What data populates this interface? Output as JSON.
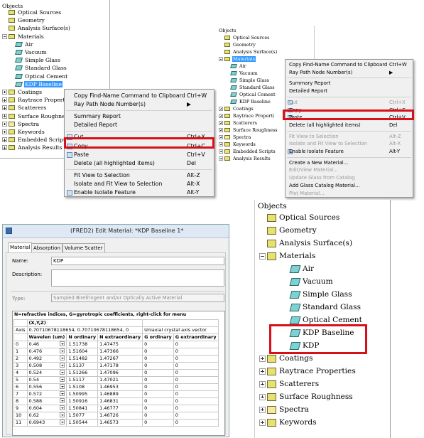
{
  "panel_a": {
    "tree_title": "Objects",
    "items": [
      {
        "label": "Optical Sources",
        "icon": "optical-sources-icon"
      },
      {
        "label": "Geometry",
        "icon": "geometry-icon"
      },
      {
        "label": "Analysis Surface(s)",
        "icon": "analysis-surface-icon"
      },
      {
        "label": "Materials",
        "icon": "materials-folder-icon"
      },
      {
        "label": "Air",
        "icon": "material-icon"
      },
      {
        "label": "Vacuum",
        "icon": "material-icon"
      },
      {
        "label": "Simple Glass",
        "icon": "material-icon"
      },
      {
        "label": "Standard Glass",
        "icon": "material-icon"
      },
      {
        "label": "Optical Cement",
        "icon": "material-icon"
      },
      {
        "label": "KDP Baseline",
        "icon": "material-icon"
      },
      {
        "label": "Coatings",
        "icon": "coatings-icon"
      },
      {
        "label": "Raytrace Propert",
        "icon": "raytrace-properties-icon"
      },
      {
        "label": "Scatterers",
        "icon": "scatterers-icon"
      },
      {
        "label": "Surface Roughne",
        "icon": "surface-roughness-icon"
      },
      {
        "label": "Spectra",
        "icon": "spectra-icon"
      },
      {
        "label": "Keywords",
        "icon": "keywords-icon"
      },
      {
        "label": "Embedded Scripts",
        "icon": "embedded-scripts-icon"
      },
      {
        "label": "Analysis Results",
        "icon": "analysis-results-icon"
      }
    ],
    "menu": [
      {
        "label": "Copy Find-Name Command to Clipboard",
        "shortcut": "Ctrl+W"
      },
      {
        "label": "Ray Path Node Number(s)",
        "shortcut": "▶"
      },
      {
        "label": "Summary Report",
        "shortcut": ""
      },
      {
        "label": "Detailed Report",
        "shortcut": ""
      },
      {
        "label": "Cut",
        "shortcut": "Ctrl+X"
      },
      {
        "label": "Copy",
        "shortcut": "Ctrl+C"
      },
      {
        "label": "Paste",
        "shortcut": "Ctrl+V"
      },
      {
        "label": "Delete (all highlighted items)",
        "shortcut": "Del"
      },
      {
        "label": "Fit View to Selection",
        "shortcut": "Alt-Z"
      },
      {
        "label": "Isolate and Fit View to Selection",
        "shortcut": "Alt-X"
      },
      {
        "label": "Enable Isolate Feature",
        "shortcut": "Alt-Y"
      }
    ]
  },
  "panel_b": {
    "tree_title": "Objects",
    "items": [
      {
        "label": "Optical Sources",
        "icon": "optical-sources-icon"
      },
      {
        "label": "Geometry",
        "icon": "geometry-icon"
      },
      {
        "label": "Analysis Surface(s)",
        "icon": "analysis-surface-icon"
      },
      {
        "label": "Materials",
        "icon": "materials-folder-icon"
      },
      {
        "label": "Air",
        "icon": "material-icon"
      },
      {
        "label": "Vacuum",
        "icon": "material-icon"
      },
      {
        "label": "Simple Glass",
        "icon": "material-icon"
      },
      {
        "label": "Standard Glass",
        "icon": "material-icon"
      },
      {
        "label": "Optical Cement",
        "icon": "material-icon"
      },
      {
        "label": "KDP Baseline",
        "icon": "material-icon"
      },
      {
        "label": "Coatings",
        "icon": "coatings-icon"
      },
      {
        "label": "Raytrace Properti",
        "icon": "raytrace-properties-icon"
      },
      {
        "label": "Scatterers",
        "icon": "scatterers-icon"
      },
      {
        "label": "Surface Roughness",
        "icon": "surface-roughness-icon"
      },
      {
        "label": "Spectra",
        "icon": "spectra-icon"
      },
      {
        "label": "Keywords",
        "icon": "keywords-icon"
      },
      {
        "label": "Embedded Scripts",
        "icon": "embedded-scripts-icon"
      },
      {
        "label": "Analysis Results",
        "icon": "analysis-results-icon"
      }
    ],
    "menu": [
      {
        "label": "Copy Find-Name Command to Clipboard",
        "shortcut": "Ctrl+W"
      },
      {
        "label": "Ray Path Node Number(s)",
        "shortcut": "▶"
      },
      {
        "label": "Summary Report",
        "shortcut": ""
      },
      {
        "label": "Detailed Report",
        "shortcut": ""
      },
      {
        "label": "Cut",
        "shortcut": "Ctrl+X"
      },
      {
        "label": "Copy",
        "shortcut": "Ctrl+C"
      },
      {
        "label": "Paste",
        "shortcut": "Ctrl+V"
      },
      {
        "label": "Delete (all highlighted items)",
        "shortcut": "Del"
      },
      {
        "label": "Fit View to Selection",
        "shortcut": "Alt-Z"
      },
      {
        "label": "Isolate and Fit View to Selection",
        "shortcut": "Alt-X"
      },
      {
        "label": "Enable Isolate Feature",
        "shortcut": "Alt-Y"
      },
      {
        "label": "Create a New Material...",
        "shortcut": ""
      },
      {
        "label": "Edit/View Material...",
        "shortcut": ""
      },
      {
        "label": "Update Glass from Catalog",
        "shortcut": ""
      },
      {
        "label": "Add Glass Catalog Material...",
        "shortcut": ""
      },
      {
        "label": "Plot Material...",
        "shortcut": ""
      }
    ]
  },
  "panel_c": {
    "title": "(FRED2) Edit Material: *KDP Baseline 1*",
    "tabs": [
      "Material",
      "Absorption",
      "Volume Scatter"
    ],
    "name_label": "Name:",
    "name_value": "KDP",
    "description_label": "Description:",
    "type_label": "Type:",
    "type_value": "Sampled Birefringent and/or Optically Active Material",
    "grid_caption": "N=refractive indices, G=gyrotropic coefficients,  right-click for menu",
    "axis_header": "(X,Y,Z)",
    "axis_label": "Axis",
    "axis_value": "0.70710678118654, 0.70710678118654, 0",
    "axis_note": "Uniaxial crystal axis vector",
    "columns": [
      "Wavelen (um)",
      "N ordinary",
      "N extraordinary",
      "G ordinary",
      "G extraordinary"
    ],
    "rows": [
      [
        "0",
        "0.46",
        "1.51738",
        "1.47475",
        "0",
        "0"
      ],
      [
        "1",
        "0.476",
        "1.51604",
        "1.47366",
        "0",
        "0"
      ],
      [
        "2",
        "0.492",
        "1.51482",
        "1.47267",
        "0",
        "0"
      ],
      [
        "3",
        "0.508",
        "1.5137",
        "1.47178",
        "0",
        "0"
      ],
      [
        "4",
        "0.524",
        "1.51266",
        "1.47096",
        "0",
        "0"
      ],
      [
        "5",
        "0.54",
        "1.5117",
        "1.47021",
        "0",
        "0"
      ],
      [
        "6",
        "0.556",
        "1.5108",
        "1.46953",
        "0",
        "0"
      ],
      [
        "7",
        "0.572",
        "1.50995",
        "1.46889",
        "0",
        "0"
      ],
      [
        "8",
        "0.588",
        "1.50916",
        "1.46831",
        "0",
        "0"
      ],
      [
        "9",
        "0.604",
        "1.50841",
        "1.46777",
        "0",
        "0"
      ],
      [
        "10",
        "0.62",
        "1.5077",
        "1.46726",
        "0",
        "0"
      ],
      [
        "11",
        "0.6943",
        "1.50544",
        "1.46573",
        "0",
        "0"
      ]
    ]
  },
  "panel_d": {
    "tree_title": "Objects",
    "items": [
      {
        "label": "Optical Sources",
        "icon": "optical-sources-icon"
      },
      {
        "label": "Geometry",
        "icon": "geometry-icon"
      },
      {
        "label": "Analysis Surface(s)",
        "icon": "analysis-surface-icon"
      },
      {
        "label": "Materials",
        "icon": "materials-folder-icon"
      },
      {
        "label": "Air",
        "icon": "material-icon"
      },
      {
        "label": "Vacuum",
        "icon": "material-icon"
      },
      {
        "label": "Simple Glass",
        "icon": "material-icon"
      },
      {
        "label": "Standard Glass",
        "icon": "material-icon"
      },
      {
        "label": "Optical Cement",
        "icon": "material-icon"
      },
      {
        "label": "KDP Baseline",
        "icon": "material-icon"
      },
      {
        "label": "KDP",
        "icon": "material-icon"
      },
      {
        "label": "Coatings",
        "icon": "coatings-icon"
      },
      {
        "label": "Raytrace Properties",
        "icon": "raytrace-properties-icon"
      },
      {
        "label": "Scatterers",
        "icon": "scatterers-icon"
      },
      {
        "label": "Surface Roughness",
        "icon": "surface-roughness-icon"
      },
      {
        "label": "Spectra",
        "icon": "spectra-icon"
      },
      {
        "label": "Keywords",
        "icon": "keywords-icon"
      }
    ]
  },
  "colors": {
    "highlight": "#d8101a",
    "selection": "#3399ff"
  }
}
